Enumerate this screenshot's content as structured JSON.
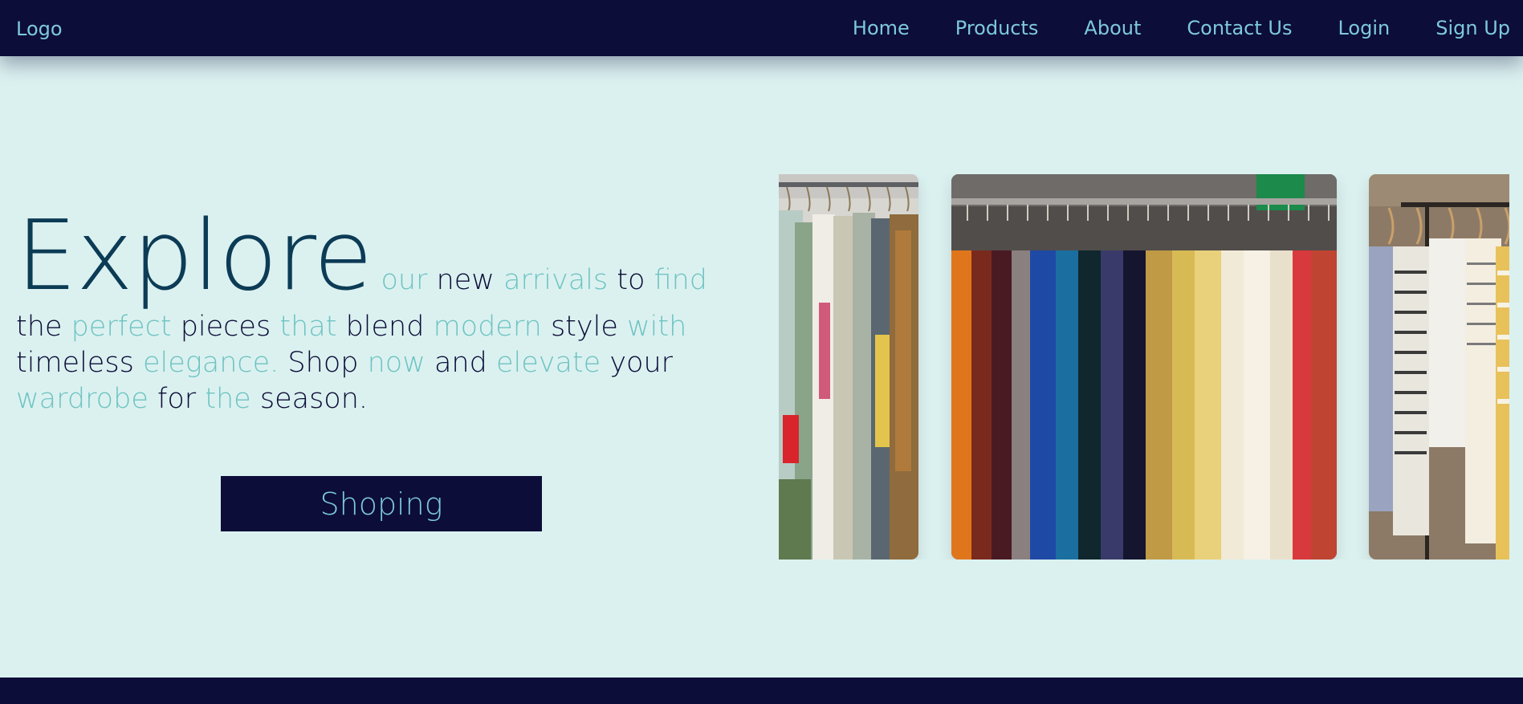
{
  "navbar": {
    "logo": "Logo",
    "links": [
      "Home",
      "Products",
      "About",
      "Contact Us",
      "Login",
      "Sign Up"
    ]
  },
  "hero": {
    "headline_big": "Explore",
    "text_parts": [
      {
        "t": "our",
        "c": "hl"
      },
      {
        "t": "new",
        "c": "dk"
      },
      {
        "t": "arrivals",
        "c": "hl"
      },
      {
        "t": "to",
        "c": "dk"
      },
      {
        "t": "find",
        "c": "hl"
      },
      {
        "t": "the",
        "c": "dk"
      },
      {
        "t": "perfect",
        "c": "hl"
      },
      {
        "t": "pieces",
        "c": "dk"
      },
      {
        "t": "that",
        "c": "hl"
      },
      {
        "t": "blend",
        "c": "dk"
      },
      {
        "t": "modern",
        "c": "hl"
      },
      {
        "t": "style",
        "c": "dk"
      },
      {
        "t": "with",
        "c": "hl"
      },
      {
        "t": "timeless",
        "c": "dk"
      },
      {
        "t": "elegance.",
        "c": "hl"
      },
      {
        "t": "Shop",
        "c": "dk"
      },
      {
        "t": "now",
        "c": "hl"
      },
      {
        "t": "and",
        "c": "dk"
      },
      {
        "t": "elevate",
        "c": "hl"
      },
      {
        "t": "your",
        "c": "dk"
      },
      {
        "t": "wardrobe",
        "c": "hl"
      },
      {
        "t": "for",
        "c": "dk"
      },
      {
        "t": "the",
        "c": "hl"
      },
      {
        "t": "season.",
        "c": "dk"
      }
    ],
    "button_label": "Shoping"
  },
  "carousel": {
    "slides": [
      "clothes-rack-image",
      "colorful-shirts-rack-image",
      "striped-dresses-rack-image"
    ]
  },
  "colors": {
    "navbar_bg": "#0c0d38",
    "nav_text": "#7ec9dc",
    "page_bg": "#dbf1f0",
    "highlight": "#6fc4c2",
    "heading": "#0c3b55"
  }
}
